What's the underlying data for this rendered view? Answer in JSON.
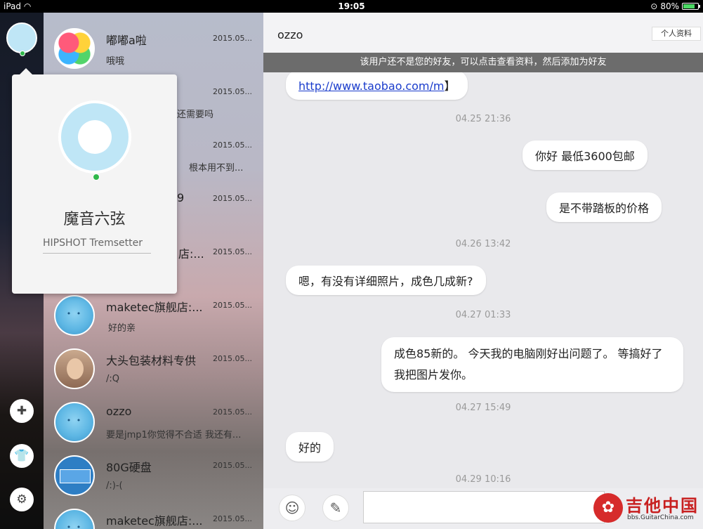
{
  "status_bar": {
    "device": "iPad",
    "time": "19:05",
    "battery": "80%",
    "battery_level": 0.8
  },
  "rail": {
    "icons": [
      "chat-add-icon",
      "shirt-icon",
      "gear-icon"
    ]
  },
  "conversations": [
    {
      "name": "嘟嘟a啦",
      "date": "2015.05...",
      "message": "哦哦",
      "avatar": "game"
    },
    {
      "name": "",
      "date": "2015.05...",
      "message": "还需要吗",
      "avatar": "hidden"
    },
    {
      "name": "",
      "date": "2015.05...",
      "message": "根本用不到...",
      "avatar": "hidden"
    },
    {
      "name": "9",
      "date": "2015.05...",
      "message": "",
      "avatar": "hidden"
    },
    {
      "name": "店:...",
      "date": "2015.05...",
      "message": "",
      "avatar": "hidden"
    },
    {
      "name": "maketec旗舰店:...",
      "date": "2015.05...",
      "message": "好的亲",
      "avatar": "qq"
    },
    {
      "name": "大头包装材料专供",
      "date": "2015.05...",
      "message": "/:Q",
      "avatar": "photo"
    },
    {
      "name": "ozzo",
      "date": "2015.05...",
      "message": "要是jmp1你觉得不合适  我还有...",
      "avatar": "qq"
    },
    {
      "name": "80G硬盘",
      "date": "2015.05...",
      "message": "/:)-(",
      "avatar": "blue"
    },
    {
      "name": "maketec旗舰店:...",
      "date": "2015.05...",
      "message": "",
      "avatar": "qq"
    }
  ],
  "popup": {
    "name": "魔音六弦",
    "signature": "HIPSHOT Tremsetter"
  },
  "chat": {
    "title": "ozzo",
    "profile_button": "个人资料",
    "notice": "该用户还不是您的好友，可以点击查看资料，然后添加为好友",
    "messages": [
      {
        "type": "in",
        "text": "http://www.taobao.com/m",
        "suffix": "】"
      },
      {
        "type": "time",
        "text": "04.25 21:36"
      },
      {
        "type": "out",
        "text": "你好   最低3600包邮"
      },
      {
        "type": "out",
        "text": "是不带踏板的价格"
      },
      {
        "type": "time",
        "text": "04.26 13:42"
      },
      {
        "type": "in",
        "text": "嗯，有没有详细照片，成色几成新?"
      },
      {
        "type": "time",
        "text": "04.27 01:33"
      },
      {
        "type": "out",
        "text": "成色85新的。 今天我的电脑刚好出问题了。 等搞好了我把图片发你。"
      },
      {
        "type": "time",
        "text": "04.27 15:49"
      },
      {
        "type": "in",
        "text": "好的"
      },
      {
        "type": "time",
        "text": "04.29 10:16"
      }
    ],
    "input": {
      "value": ""
    }
  },
  "watermark": {
    "text": "吉他中国",
    "sub": "bbs.GuitarChina.com"
  }
}
